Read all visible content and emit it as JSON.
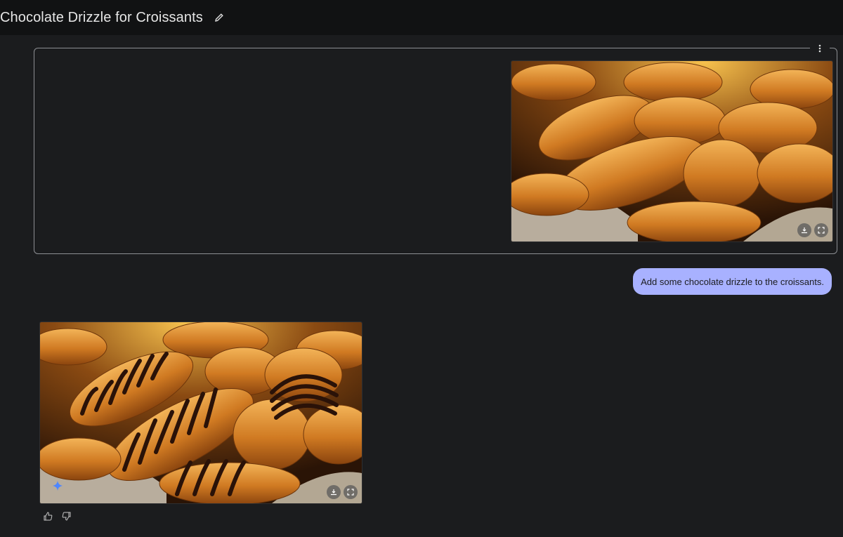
{
  "header": {
    "title": "Chocolate Drizzle for Croissants",
    "edit_icon": "pencil-icon"
  },
  "conversation": {
    "input_card": {
      "menu_icon": "more-vertical-icon",
      "image_actions": [
        "download-icon",
        "fullscreen-icon"
      ]
    },
    "user_message": "Add some chocolate drizzle to the croissants.",
    "response": {
      "image_actions": [
        "download-icon",
        "fullscreen-icon"
      ],
      "badge_icon": "sparkle-icon",
      "feedback_icons": [
        "thumbs-up-icon",
        "thumbs-down-icon"
      ]
    }
  },
  "colors": {
    "background": "#1b1c1e",
    "topbar": "#111213",
    "bubble": "#a8b1ff"
  }
}
